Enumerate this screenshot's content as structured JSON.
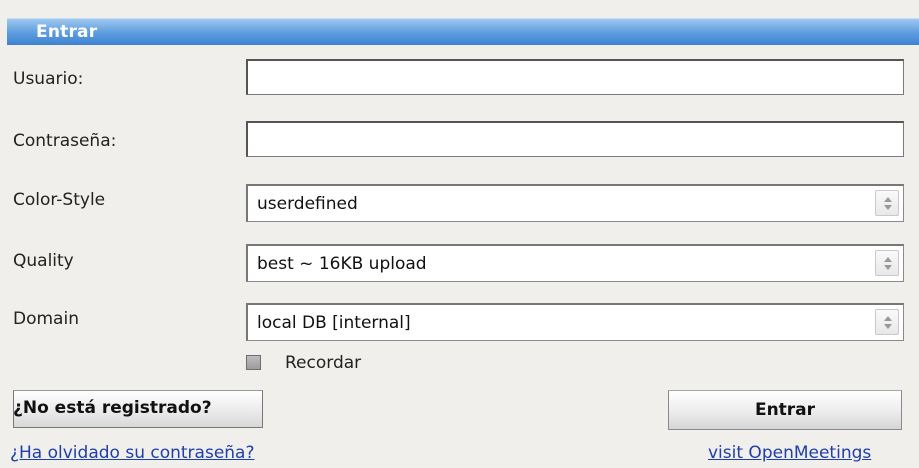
{
  "header": {
    "title": "Entrar"
  },
  "form": {
    "username_label": "Usuario:",
    "username_value": "",
    "password_label": "Contraseña:",
    "password_value": "",
    "color_style_label": "Color-Style",
    "color_style_value": "userdefined",
    "quality_label": "Quality",
    "quality_value": "best ~ 16KB upload",
    "domain_label": "Domain",
    "domain_value": "local DB [internal]",
    "remember_label": "Recordar",
    "remember_checked": false
  },
  "actions": {
    "register_label": "¿No está registrado?",
    "login_label": "Entrar",
    "forgot_password_label": "¿Ha olvidado su contraseña?",
    "visit_label": "visit OpenMeetings"
  },
  "colors": {
    "title_bar": "#5b9bde",
    "panel_background": "#f0efeb",
    "link": "#1e3fa8"
  },
  "icons": {
    "select_spinner": "spinner-arrows-icon",
    "checkbox": "checkbox-icon"
  }
}
